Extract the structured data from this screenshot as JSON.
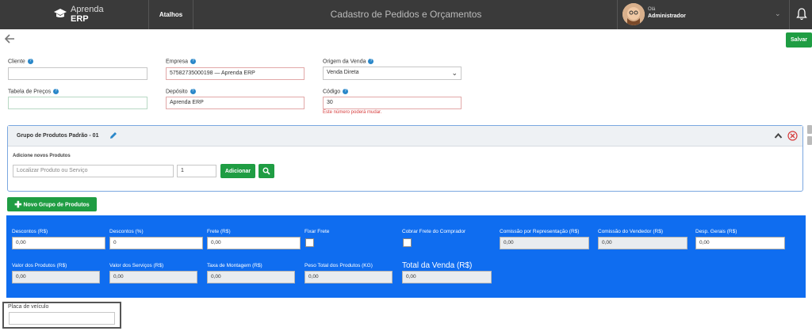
{
  "header": {
    "logo_line1": "Aprenda",
    "logo_line2": "ERP",
    "shortcuts": "Atalhos",
    "page_title": "Cadastro de Pedidos e Orçamentos",
    "greeting": "Olá",
    "user_name": "Administrador"
  },
  "toolbar": {
    "save_label": "Salvar"
  },
  "form": {
    "cliente_label": "Cliente",
    "cliente_value": "",
    "empresa_label": "Empresa",
    "empresa_value": "57582735000198 — Aprenda ERP",
    "origem_label": "Origem da Venda",
    "origem_value": "Venda Direta",
    "tabela_label": "Tabela de Preços",
    "tabela_value": "",
    "deposito_label": "Depósito",
    "deposito_value": "Aprenda ERP",
    "codigo_label": "Código",
    "codigo_value": "30",
    "codigo_warning": "Este número poderá mudar."
  },
  "group": {
    "title": "Grupo de Produtos Padrão - 01",
    "add_products_label": "Adicione novos Produtos",
    "search_placeholder": "Localizar Produto ou Serviço",
    "quantity": "1",
    "add_button": "Adicionar"
  },
  "new_group_button": "Novo Grupo de Produtos",
  "totals": {
    "descontos_rs_label": "Descontos (R$)",
    "descontos_rs_value": "0,00",
    "descontos_pct_label": "Descontos (%)",
    "descontos_pct_value": "0",
    "frete_label": "Frete (R$)",
    "frete_value": "0,00",
    "fixar_frete_label": "Fixar Frete",
    "cobrar_frete_label": "Cobrar Frete do Comprador",
    "comissao_rep_label": "Comissão por Representação (R$)",
    "comissao_rep_value": "0,00",
    "comissao_vend_label": "Comissão do Vendedor (R$)",
    "comissao_vend_value": "0,00",
    "desp_gerais_label": "Desp. Gerais (R$)",
    "desp_gerais_value": "0,00",
    "valor_produtos_label": "Valor dos Produtos (R$)",
    "valor_produtos_value": "0,00",
    "valor_servicos_label": "Valor dos Serviços (R$)",
    "valor_servicos_value": "0,00",
    "montagem_label": "Taxa de Montagem (R$)",
    "montagem_value": "0,00",
    "peso_label": "Peso Total dos Produtos (KG)",
    "peso_value": "0,00",
    "total_label": "Total da Venda (R$)",
    "total_value": "0,00"
  },
  "placa": {
    "label": "Placa de veículo",
    "value": ""
  },
  "colors": {
    "topbar": "#3a3a3a",
    "green": "#1f9d43",
    "blue_panel": "#0f6df0",
    "help_icon": "#2a87c9"
  }
}
